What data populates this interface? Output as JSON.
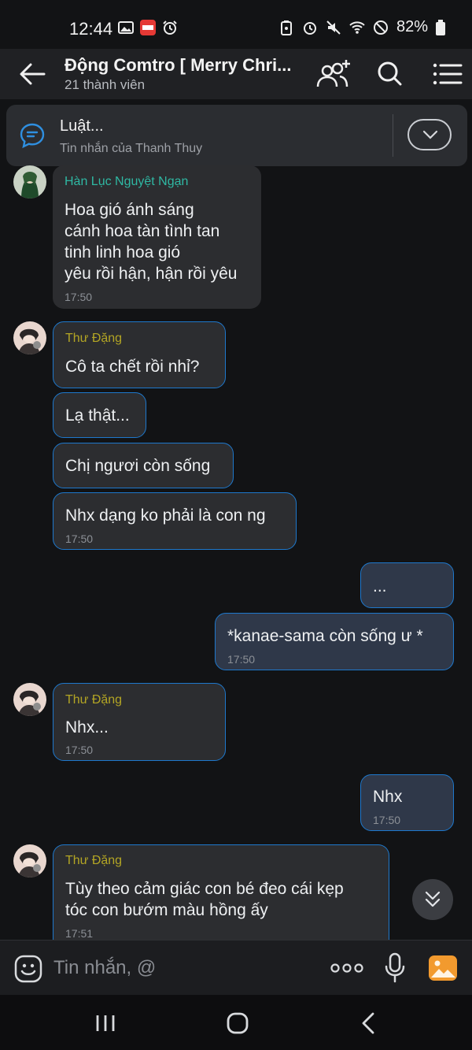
{
  "status_bar": {
    "time": "12:44",
    "battery": "82%"
  },
  "header": {
    "title": "Động Comtro [ Merry Chri...",
    "subtitle": "21 thành viên"
  },
  "pinned": {
    "title": "Luật...",
    "subtitle": "Tin nhắn của Thanh Thuy"
  },
  "messages": [
    {
      "sender": "Hàn Lục Nguyệt Ngạn",
      "lines": [
        "Hoa gió ánh sáng",
        "cánh hoa tàn tình tan",
        "tinh linh hoa gió",
        "yêu rồi hận, hận rồi yêu"
      ],
      "time": "17:50"
    },
    {
      "sender": "Thư Đặng",
      "lines": [
        "Cô ta chết rồi nhỉ?"
      ]
    },
    {
      "lines": [
        "Lạ thật..."
      ]
    },
    {
      "lines": [
        "Chị ngươi còn sống"
      ]
    },
    {
      "lines": [
        "Nhx dạng ko phải là con ng"
      ],
      "time": "17:50"
    },
    {
      "lines": [
        "..."
      ]
    },
    {
      "lines": [
        "*kanae-sama còn sống ư *"
      ],
      "time": "17:50"
    },
    {
      "sender": "Thư Đặng",
      "lines": [
        "Nhx..."
      ],
      "time": "17:50"
    },
    {
      "lines": [
        "Nhx"
      ],
      "time": "17:50"
    },
    {
      "sender": "Thư Đặng",
      "lines": [
        "Tùy theo cảm giác con bé đeo cái kẹp",
        "tóc con bướm màu hồng ấy"
      ],
      "time": "17:51"
    }
  ],
  "composer": {
    "placeholder": "Tin nhắn, @"
  },
  "colors": {
    "sender_teal": "#2fb8a3",
    "sender_olive": "#b3a524",
    "bubble_border": "#1e78cc",
    "gallery_orange": "#f29a2e"
  },
  "icons": [
    "back-arrow-icon",
    "add-member-icon",
    "search-icon",
    "menu-icon",
    "chat-bubble-icon",
    "chevron-down-icon",
    "double-chevron-down-icon",
    "emoji-icon",
    "more-dots-icon",
    "mic-icon",
    "gallery-icon",
    "recents-icon",
    "home-icon",
    "nav-back-icon"
  ]
}
